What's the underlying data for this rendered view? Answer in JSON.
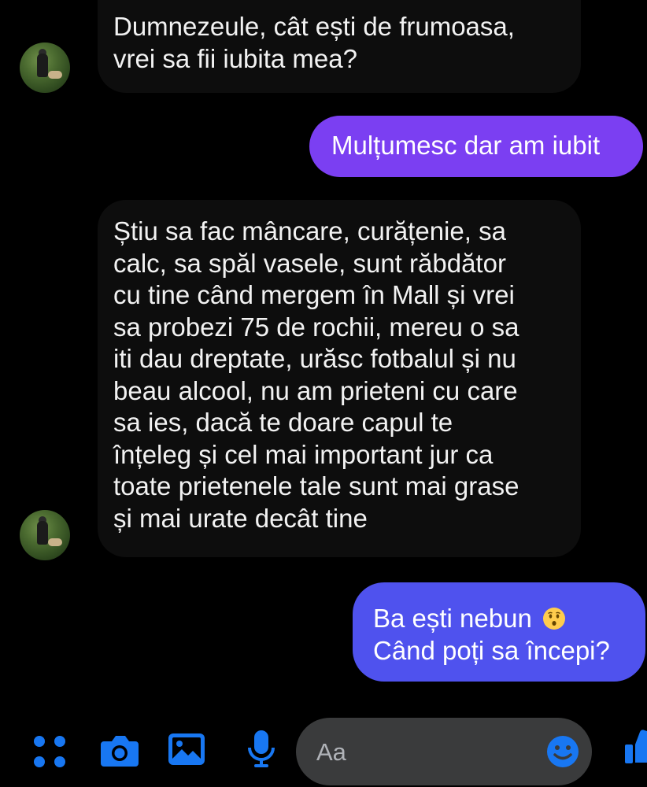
{
  "messages": [
    {
      "direction": "incoming",
      "lines": [
        "Dumnezeule, cât ești de frumoasa,",
        "vrei sa fii iubita mea?"
      ]
    },
    {
      "direction": "outgoing",
      "text": "Mulțumesc dar am iubit",
      "color": "#7b3ff2"
    },
    {
      "direction": "incoming",
      "lines": [
        "Știu sa fac mâncare, curățenie, sa",
        "calc, sa spăl vasele, sunt răbdător",
        "cu tine când mergem în Mall și vrei",
        "sa probezi 75 de rochii, mereu o sa",
        "iti dau dreptate, urăsc fotbalul și nu",
        "beau alcool, nu am prieteni cu care",
        "sa ies, dacă te doare capul te",
        "înțeleg și cel mai important jur ca",
        "toate prietenele tale sunt mai grase",
        "și mai urate decât tine"
      ]
    },
    {
      "direction": "outgoing",
      "lines": [
        "Ba ești nebun",
        "Când poți sa începi?"
      ],
      "emoji": "hushed-face-emoji",
      "color": "#4f52ee"
    }
  ],
  "composer": {
    "placeholder": "Aa"
  },
  "toolbar": {
    "icons": [
      "menu-dots-icon",
      "camera-icon",
      "image-icon",
      "microphone-icon",
      "emoji-icon",
      "thumbs-up-icon"
    ],
    "accent_color": "#1877f2"
  }
}
